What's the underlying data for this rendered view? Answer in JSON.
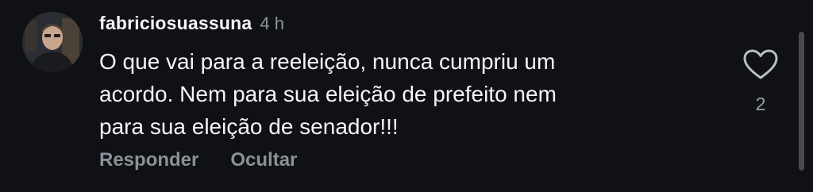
{
  "comment": {
    "username": "fabriciosuassuna",
    "time": "4 h",
    "lines": [
      "O que vai para a reeleição, nunca cumpriu um",
      "acordo. Nem para sua eleição de prefeito nem",
      "para sua eleição de senador!!!"
    ],
    "reply_label": "Responder",
    "hide_label": "Ocultar",
    "like_count": "2",
    "avatar_icon": "user-avatar-photo",
    "like_icon": "heart-outline-icon"
  },
  "colors": {
    "background": "#0f1115",
    "text": "#f4f5f7",
    "muted": "#8b9099"
  }
}
